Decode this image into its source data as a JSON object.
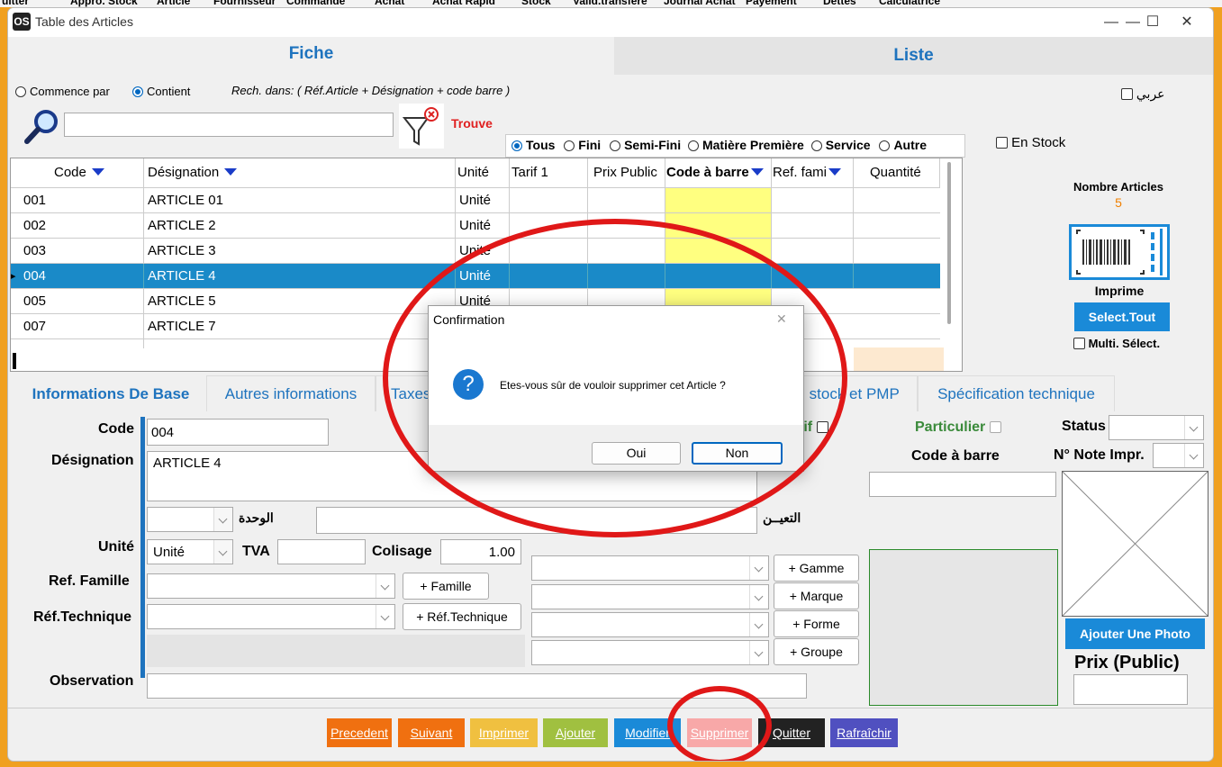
{
  "topmenu": [
    "uitter",
    "Appro. Stock",
    "Article",
    "Fournisseur",
    "Commande",
    "Achat",
    "Achat Rapid",
    "Stock",
    "Valid.transfére",
    "Journal Achat",
    "Payement",
    "Dettes",
    "Calculatrice"
  ],
  "window": {
    "title": "Table des Articles",
    "logo": "OS",
    "minimize": "—",
    "maximize": "☐",
    "close": "✕"
  },
  "tabs": {
    "fiche": "Fiche",
    "liste": "Liste"
  },
  "search": {
    "mode_starts": "Commence par",
    "mode_contains": "Contient",
    "scope_text": "Rech. dans: ( Réf.Article + Désignation + code barre )",
    "arabic_label": "عربي",
    "value": "",
    "found_label": "Trouve",
    "icon": "magnifier-icon",
    "filter_icon": "filter-clear-icon"
  },
  "type_filters": {
    "all": "Tous",
    "finished": "Fini",
    "semi": "Semi-Fini",
    "raw": "Matière Première",
    "service": "Service",
    "other": "Autre"
  },
  "en_stock": "En Stock",
  "grid": {
    "headers": {
      "code": "Code",
      "designation": "Désignation",
      "unite": "Unité",
      "tarif": "Tarif 1",
      "prix_public": "Prix Public",
      "code_barre": "Code à barre",
      "ref_famille": "Ref. fami",
      "quantite": "Quantité"
    },
    "rows": [
      {
        "code": "001",
        "designation": "ARTICLE 01",
        "unite": "Unité"
      },
      {
        "code": "002",
        "designation": "ARTICLE 2",
        "unite": "Unité"
      },
      {
        "code": "003",
        "designation": "ARTICLE 3",
        "unite": "Unité"
      },
      {
        "code": "004",
        "designation": "ARTICLE 4",
        "unite": "Unité"
      },
      {
        "code": "005",
        "designation": "ARTICLE 5",
        "unite": "Unité"
      },
      {
        "code": "007",
        "designation": "ARTICLE 7",
        "unite": ""
      }
    ],
    "row_marker": "▸"
  },
  "side": {
    "count_label": "Nombre Articles",
    "count_value": "5",
    "barcode_icon": "barcode-print-icon",
    "print_label": "Imprime",
    "select_all": "Select.Tout",
    "multi_select": "Multi. Sélect."
  },
  "detail_tabs": {
    "base": "Informations De Base",
    "autres": "Autres informations",
    "taxes": "Taxes",
    "stock": ". stock et PMP",
    "spec": "Spécification technique"
  },
  "form": {
    "code_label": "Code",
    "code_value": "004",
    "designation_label": "Désignation",
    "designation_value": "ARTICLE 4",
    "wahda_label": "الوحدة",
    "taayin_label": "التعيــن",
    "unite_label": "Unité",
    "unite_value": "Unité",
    "tva_label": "TVA",
    "tva_value": "",
    "colisage_label": "Colisage",
    "colisage_value": "1.00",
    "ref_famille_label": "Ref. Famille",
    "famille_button": "+ Famille",
    "ref_tech_label": "Réf.Technique",
    "ref_tech_button": "+ Réf.Technique",
    "observation_label": "Observation",
    "gamme_button": "+ Gamme",
    "marque_button": "+ Marque",
    "forme_button": "+ Forme",
    "groupe_button": "+ Groupe",
    "actif_label": "tif",
    "particulier_label": "Particulier",
    "code_barre_label": "Code à barre",
    "status_label": "Status",
    "note_impr_label": "N° Note Impr.",
    "add_photo_button": "Ajouter Une Photo",
    "prix_public_label": "Prix (Public)"
  },
  "bottom_buttons": {
    "precedent": "Precedent",
    "suivant": "Suivant",
    "imprimer": "Imprimer",
    "ajouter": "Ajouter",
    "modifier": "Modifier",
    "supprimer": "Supprimer",
    "quitter": "Quitter",
    "rafraichir": "Rafraîchir"
  },
  "dialog": {
    "title": "Confirmation",
    "close": "✕",
    "icon": "question-icon",
    "icon_glyph": "?",
    "message": "Etes-vous sûr de vouloir supprimer cet Article ?",
    "yes": "Oui",
    "no": "Non"
  },
  "colors": {
    "accent": "#1e73be",
    "selected_row": "#1a8ac8",
    "barcode_col": "#ffff80",
    "highlight_ring": "#e01818"
  }
}
